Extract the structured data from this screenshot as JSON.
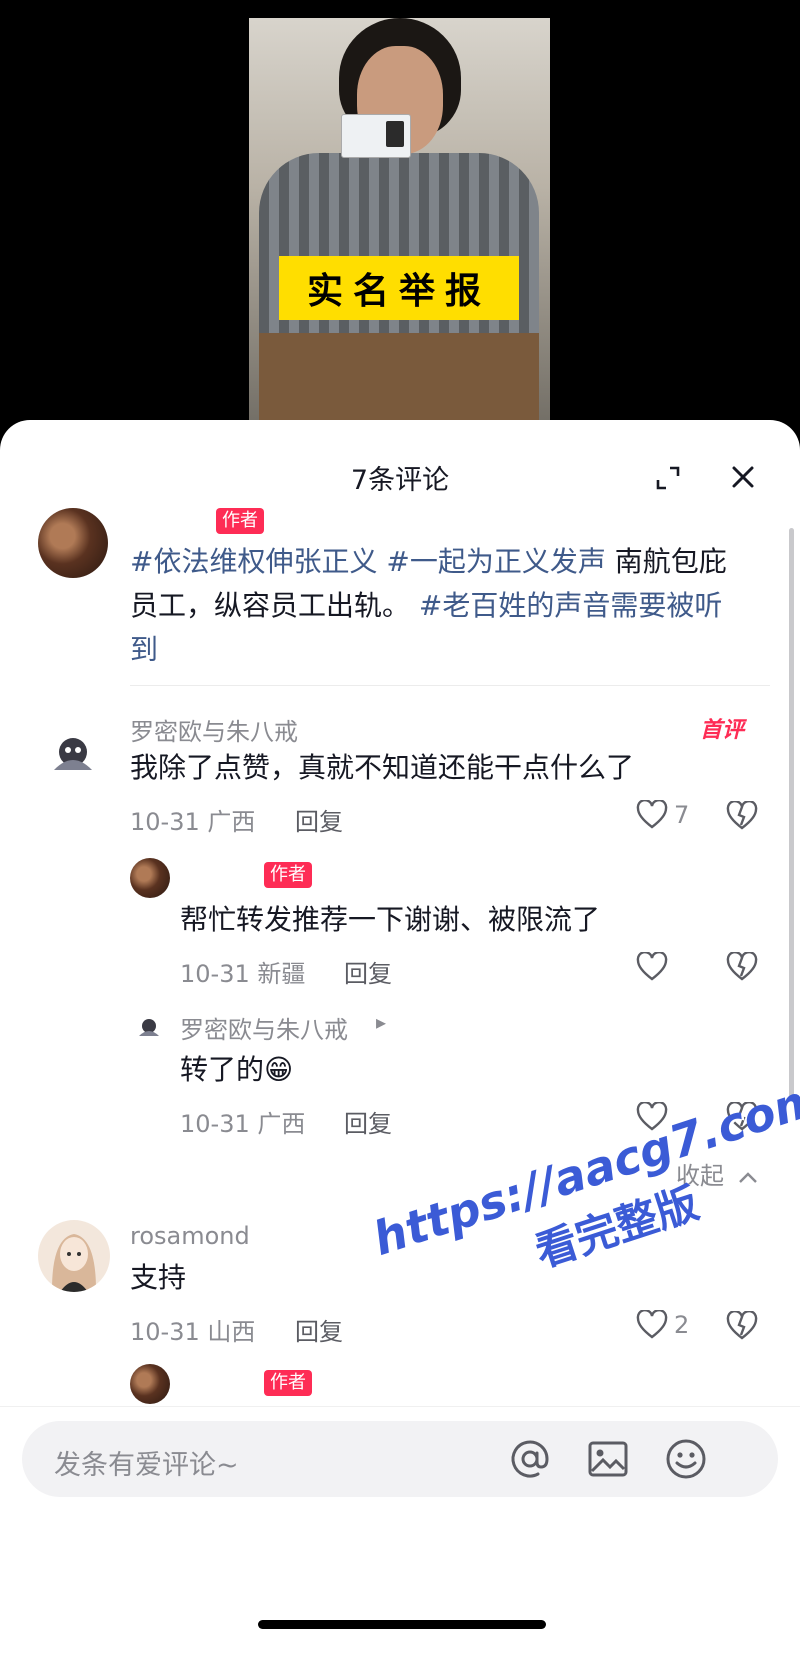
{
  "video": {
    "banner_text": "实名举报"
  },
  "sheet": {
    "title": "7条评论"
  },
  "author_post": {
    "author_tag": "作者",
    "segments": [
      {
        "text": "#依法维权伸张正义",
        "type": "hashtag"
      },
      {
        "text": " ",
        "type": "text"
      },
      {
        "text": "#一起为正义发声",
        "type": "hashtag"
      },
      {
        "text": " 南航包庇员工，纵容员工出轨。 ",
        "type": "text"
      },
      {
        "text": "#老百姓的声音需要被听到",
        "type": "hashtag"
      }
    ]
  },
  "comments": [
    {
      "username": "罗密欧与朱八戒",
      "badge": "首评",
      "text": "我除了点赞，真就不知道还能干点什么了",
      "date_location": "10-31 广西",
      "reply_label": "回复",
      "likes": "7"
    },
    {
      "author_tag": "作者",
      "text": "帮忙转发推荐一下谢谢、被限流了",
      "date_location": "10-31 新疆",
      "reply_label": "回复"
    },
    {
      "username": "罗密欧与朱八戒",
      "arrow": "▸",
      "text": "转了的😁",
      "date_location": "10-31 广西",
      "reply_label": "回复"
    },
    {
      "username": "rosamond",
      "text": "支持",
      "date_location": "10-31 山西",
      "reply_label": "回复",
      "likes": "2"
    },
    {
      "author_tag": "作者"
    }
  ],
  "collapse_label": "收起",
  "watermark": {
    "line1": "https://aacg7.com",
    "line2": "看完整版"
  },
  "input": {
    "placeholder": "发条有爱评论~"
  },
  "colors": {
    "accent": "#fe2c55",
    "hashtag": "#3f5a8a",
    "banner": "#ffde00"
  }
}
